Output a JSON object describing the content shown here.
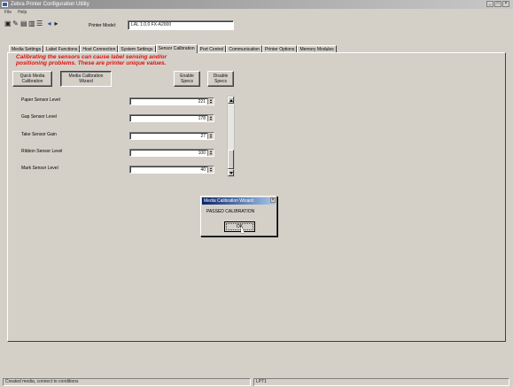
{
  "window": {
    "title": "Zebra Printer Configuration Utility",
    "controls": [
      "_",
      "□",
      "×"
    ]
  },
  "menu": [
    "File",
    "Help"
  ],
  "toolbar": {
    "icons": [
      "connect-icon",
      "open-icon",
      "save-icon",
      "print-icon",
      "settings-icon",
      "back-icon",
      "forward-icon"
    ],
    "printer_label": "Printer Model:",
    "printer_value": "LAL 1.0.0 FX-A2000"
  },
  "tabs": [
    "Media Settings",
    "Label Functions",
    "Host Connection",
    "System Settings",
    "Sensor Calibration",
    "Port Control",
    "Communication",
    "Printer Options",
    "Memory Modules"
  ],
  "active_tab": 4,
  "warning": "Calibrating the sensors can cause label sensing and/or positioning problems. These are printer unique values.",
  "buttons": {
    "quick_calibration": "Quick Media\nCalibration",
    "media_calibration_wizard": "Media Calibration\nWizard",
    "enable_specs": "Enable\nSpecs",
    "disable_specs": "Disable\nSpecs"
  },
  "sensors": [
    {
      "label": "Paper Sensor Level",
      "value": "221"
    },
    {
      "label": "Gap Sensor Level",
      "value": "178"
    },
    {
      "label": "Take Sensor Gain",
      "value": "27"
    },
    {
      "label": "Ribbon Sensor Level",
      "value": "100"
    },
    {
      "label": "Mark Sensor Level",
      "value": "40"
    }
  ],
  "dialog": {
    "title": "Media Calibration Wizard",
    "close": "×",
    "message": "PASSED CALIBRATION",
    "ok": "OK"
  },
  "status": {
    "left": "Created media, connect to conditions",
    "right": "LPT1"
  }
}
